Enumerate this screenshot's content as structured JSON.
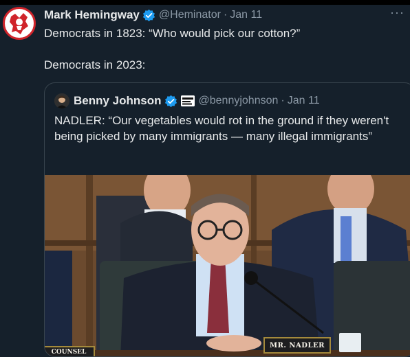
{
  "tweet": {
    "display_name": "Mark Hemingway",
    "handle": "@Heminator",
    "separator": "·",
    "date": "Jan 11",
    "more_label": "···",
    "line1": "Democrats in 1823: “Who would pick our cotton?”",
    "line2": "Democrats in 2023:"
  },
  "quote": {
    "display_name": "Benny Johnson",
    "handle": "@bennyjohnson",
    "separator": "·",
    "date": "Jan 11",
    "text": "NADLER: “Our vegetables would rot in the ground if they weren't being picked by many immigrants — many illegal immigrants”"
  },
  "media": {
    "nameplate": "MR. NADLER",
    "counsel_plate": "COUNSEL"
  },
  "colors": {
    "background": "#15202b",
    "verified": "#1d9bf0",
    "muted_text": "#8b98a5"
  },
  "icons": [
    "verified-badge-icon",
    "more-options-icon",
    "avatar-logo-icon"
  ]
}
